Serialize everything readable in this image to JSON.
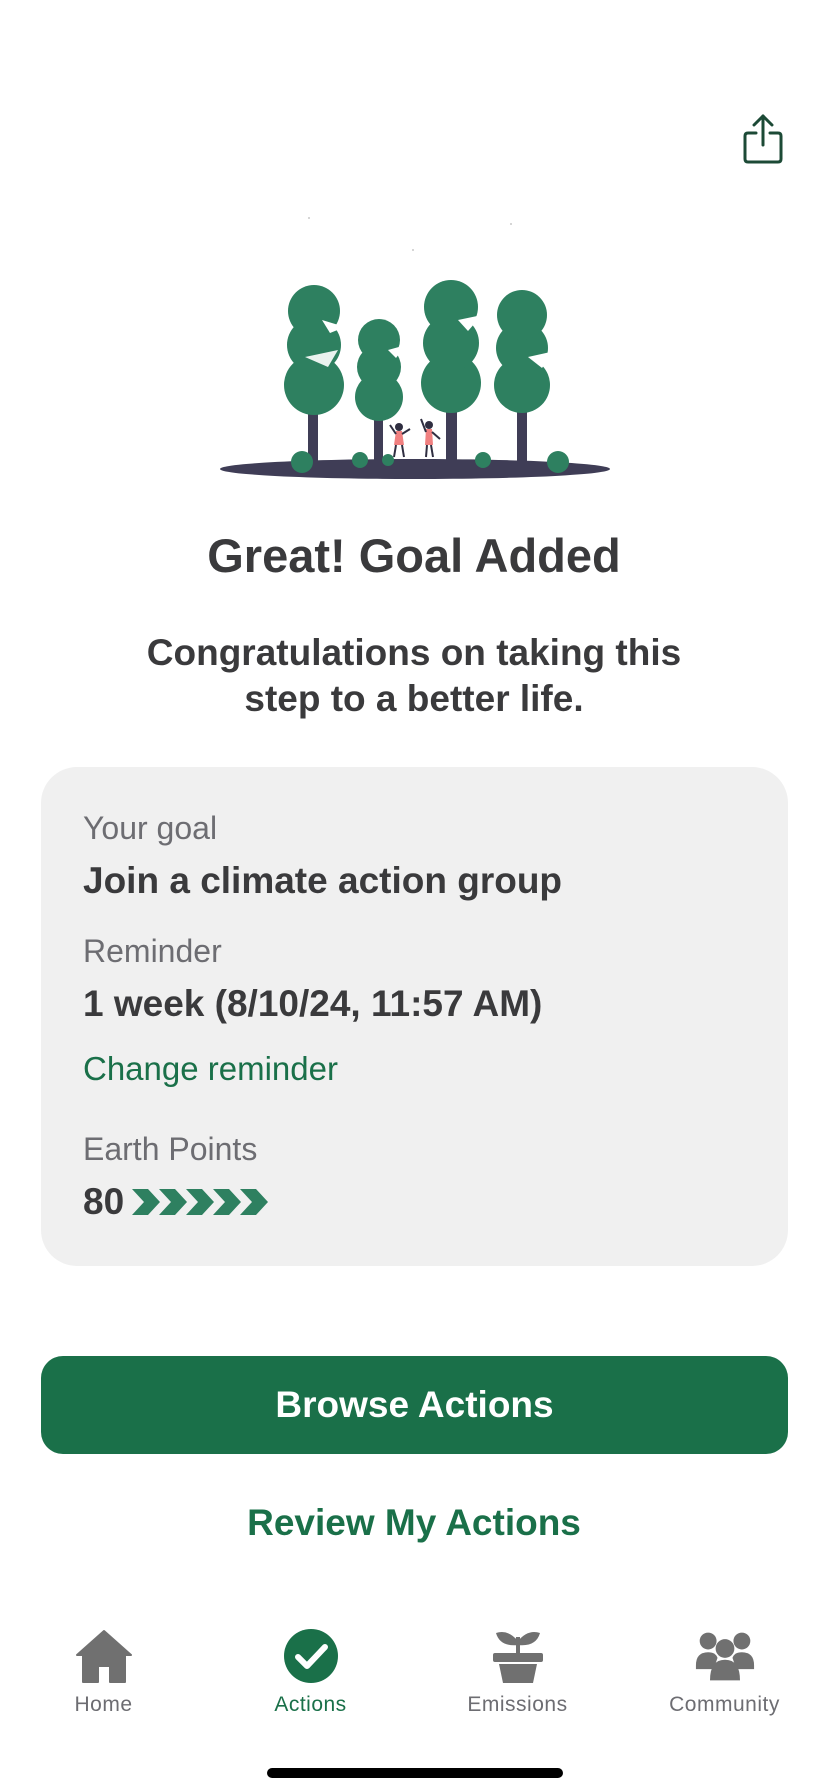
{
  "header": {
    "share_icon": "share-icon"
  },
  "illustration": {
    "icon": "trees-celebration-illustration"
  },
  "title": "Great! Goal Added",
  "subtitle": "Congratulations on taking this step to a better life.",
  "goal_card": {
    "goal_label": "Your goal",
    "goal_value": "Join a climate action group",
    "reminder_label": "Reminder",
    "reminder_value": "1 week (8/10/24, 11:57 AM)",
    "change_reminder": "Change reminder",
    "points_label": "Earth Points",
    "points_value": "80",
    "points_chevrons": 5
  },
  "buttons": {
    "browse_actions": "Browse Actions",
    "review_actions": "Review My Actions"
  },
  "tabbar": {
    "tabs": [
      {
        "label": "Home",
        "icon": "house-icon",
        "active": false
      },
      {
        "label": "Actions",
        "icon": "checkmark-circle-icon",
        "active": true
      },
      {
        "label": "Emissions",
        "icon": "sprout-pot-icon",
        "active": false
      },
      {
        "label": "Community",
        "icon": "people-group-icon",
        "active": false
      }
    ]
  },
  "colors": {
    "brand_green": "#1a7049",
    "tree_green": "#2e8060",
    "text_dark": "#3a3a3c",
    "text_muted": "#6d6d72",
    "card_bg": "#f0f0f0"
  }
}
